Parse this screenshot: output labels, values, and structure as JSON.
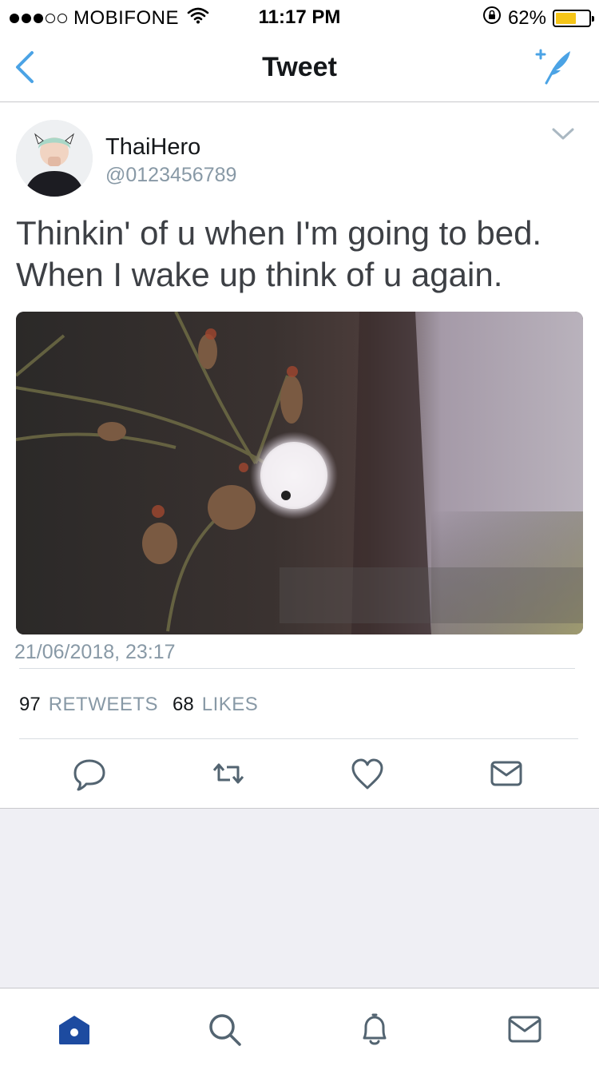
{
  "status_bar": {
    "carrier": "MOBIFONE",
    "time": "11:17 PM",
    "battery_percent": "62%",
    "battery_level": 0.62,
    "battery_color": "#f5c518",
    "signal_bars_filled": 3,
    "signal_bars_total": 5
  },
  "nav": {
    "title": "Tweet",
    "back_icon": "chevron-left-icon",
    "compose_icon": "compose-tweet-icon",
    "accent_color": "#4ba3e5"
  },
  "tweet": {
    "author_name": "ThaiHero",
    "author_handle": "@0123456789",
    "text": "Thinkin' of u when I'm going to bed. When I wake up think of u again.",
    "timestamp": "21/06/2018, 23:17",
    "retweets_count": "97",
    "retweets_label": "RETWEETS",
    "likes_count": "68",
    "likes_label": "LIKES"
  },
  "actions": [
    {
      "icon": "reply-icon"
    },
    {
      "icon": "retweet-icon"
    },
    {
      "icon": "like-icon"
    },
    {
      "icon": "direct-message-icon"
    }
  ],
  "tab_bar": {
    "items": [
      {
        "icon": "home-icon",
        "active": true
      },
      {
        "icon": "search-icon",
        "active": false
      },
      {
        "icon": "notifications-icon",
        "active": false
      },
      {
        "icon": "messages-icon",
        "active": false
      }
    ],
    "active_color": "#1d4ba0",
    "inactive_color": "#536471"
  }
}
